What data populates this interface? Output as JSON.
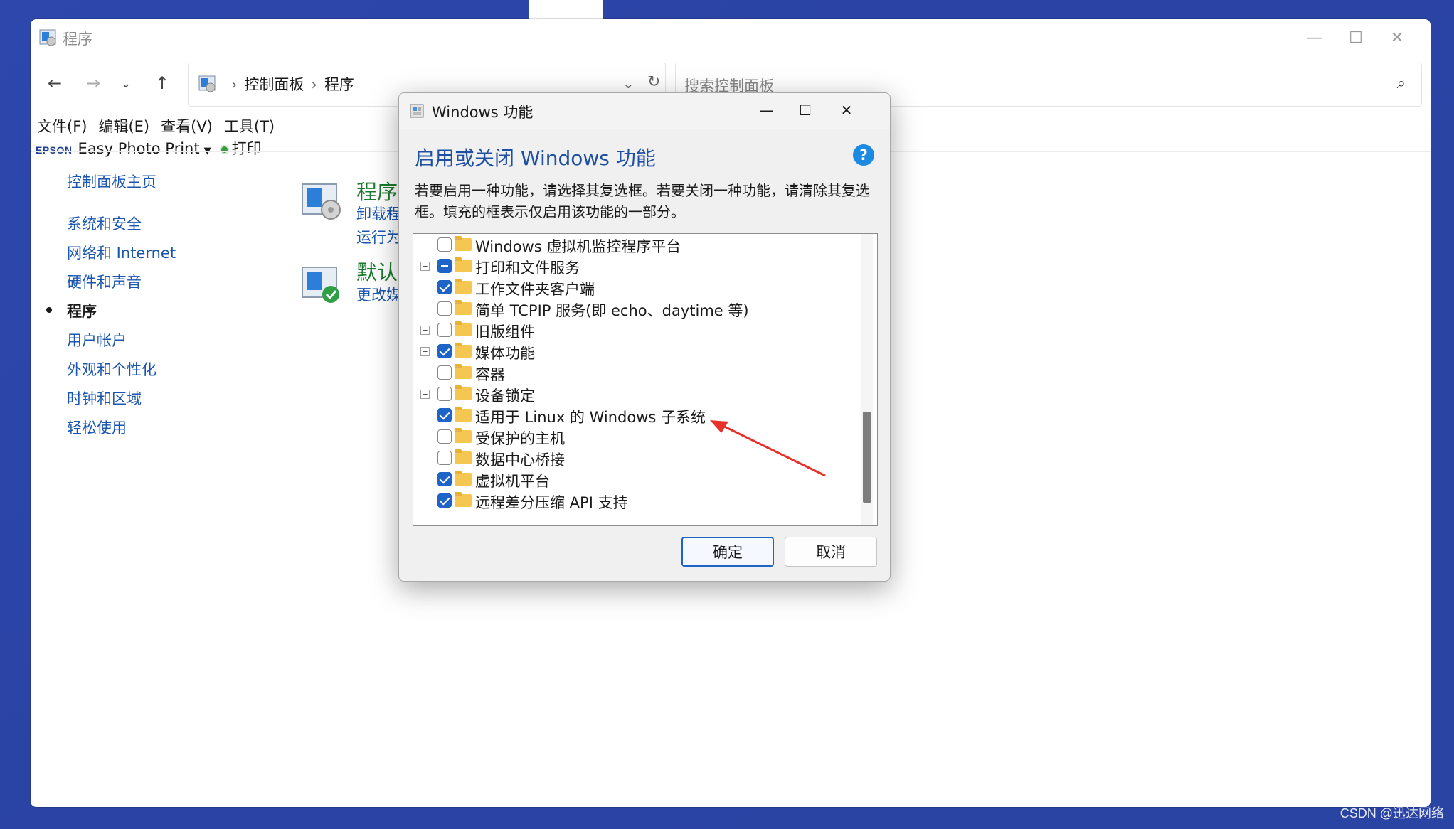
{
  "window": {
    "title": "程序",
    "controls": {
      "minimize": "—",
      "maximize": "☐",
      "close": "✕"
    }
  },
  "nav": {
    "back_icon": "←",
    "forward_icon": "→",
    "recent_icon": "⌄",
    "up_icon": "↑",
    "breadcrumb": [
      "控制面板",
      "程序"
    ],
    "breadcrumb_sep": "›",
    "dropdown_icon": "⌄",
    "refresh_icon": "↻"
  },
  "search": {
    "placeholder": "搜索控制面板",
    "icon": "⌕"
  },
  "menu": {
    "items": [
      "文件(F)",
      "编辑(E)",
      "查看(V)",
      "工具(T)"
    ]
  },
  "toolbar": {
    "epson_logo": "EPSON",
    "epson_label": "Easy Photo Print",
    "epson_arrow": "▼",
    "print_label": "打印"
  },
  "sidebar": {
    "items": [
      {
        "label": "控制面板主页",
        "active": false
      },
      {
        "label": "系统和安全",
        "active": false
      },
      {
        "label": "网络和 Internet",
        "active": false
      },
      {
        "label": "硬件和声音",
        "active": false
      },
      {
        "label": "程序",
        "active": true
      },
      {
        "label": "用户帐户",
        "active": false
      },
      {
        "label": "外观和个性化",
        "active": false
      },
      {
        "label": "时钟和区域",
        "active": false
      },
      {
        "label": "轻松使用",
        "active": false
      }
    ]
  },
  "content": {
    "sections": [
      {
        "title": "程序和",
        "links": [
          "卸载程",
          "运行为"
        ]
      },
      {
        "title": "默认和",
        "links": [
          "更改媒"
        ]
      }
    ]
  },
  "dialog": {
    "title": "Windows 功能",
    "controls": {
      "minimize": "—",
      "maximize": "☐",
      "close": "✕"
    },
    "heading": "启用或关闭 Windows 功能",
    "help": "?",
    "description": "若要启用一种功能，请选择其复选框。若要关闭一种功能，请清除其复选框。填充的框表示仅启用该功能的一部分。",
    "features": [
      {
        "label": "Windows 虚拟机监控程序平台",
        "state": "unchecked",
        "expandable": false
      },
      {
        "label": "打印和文件服务",
        "state": "partial",
        "expandable": true
      },
      {
        "label": "工作文件夹客户端",
        "state": "checked",
        "expandable": false
      },
      {
        "label": "简单 TCPIP 服务(即 echo、daytime 等)",
        "state": "unchecked",
        "expandable": false
      },
      {
        "label": "旧版组件",
        "state": "unchecked",
        "expandable": true
      },
      {
        "label": "媒体功能",
        "state": "checked",
        "expandable": true
      },
      {
        "label": "容器",
        "state": "unchecked",
        "expandable": false
      },
      {
        "label": "设备锁定",
        "state": "unchecked",
        "expandable": true
      },
      {
        "label": "适用于 Linux 的 Windows 子系统",
        "state": "checked",
        "expandable": false
      },
      {
        "label": "受保护的主机",
        "state": "unchecked",
        "expandable": false
      },
      {
        "label": "数据中心桥接",
        "state": "unchecked",
        "expandable": false
      },
      {
        "label": "虚拟机平台",
        "state": "checked",
        "expandable": false
      },
      {
        "label": "远程差分压缩 API 支持",
        "state": "checked",
        "expandable": false
      }
    ],
    "expander_symbol": "+",
    "ok_label": "确定",
    "cancel_label": "取消"
  },
  "colors": {
    "accent": "#1e63c6",
    "link": "#1a56b0",
    "section_title": "#1c7a2e",
    "annotation_arrow": "#e8312a",
    "background": "#2b44a8"
  },
  "watermark": "CSDN @迅达网络"
}
